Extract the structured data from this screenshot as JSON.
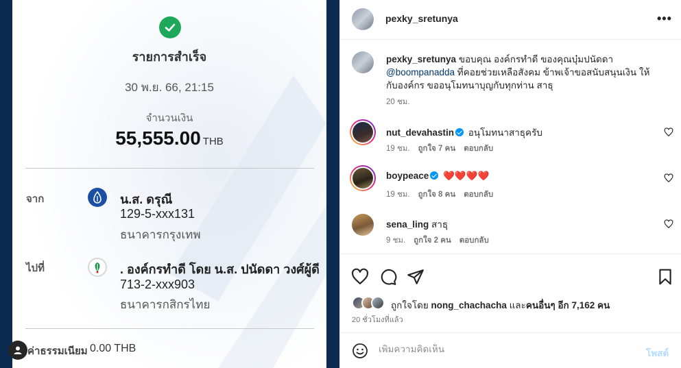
{
  "slip": {
    "title": "รายการสำเร็จ",
    "datetime": "30 พ.ย. 66, 21:15",
    "amount_label": "จำนวนเงิน",
    "amount": "55,555.00",
    "currency": "THB",
    "from_label": "จาก",
    "from_name": "น.ส. ดรุณี",
    "from_account": "129-5-xxx131",
    "from_bank": "ธนาคารกรุงเทพ",
    "to_label": "ไปที่",
    "to_name": ". องค์กรทำดี โดย น.ส. ปนัดดา  วงศ์ผู้ดี",
    "to_account": "713-2-xxx903",
    "to_bank": "ธนาคารกสิกรไทย",
    "fee_label": "ค่าธรรมเนียม",
    "fee_value": "0.00 THB"
  },
  "post": {
    "username": "pexky_sretunya",
    "more_icon": "more-horizontal-icon",
    "caption": {
      "username": "pexky_sretunya",
      "text1": "ขอบคุณ องค์กรทำดี ของคุณบุ๋มปนัดดา",
      "mention": "@boompanadda",
      "text2": "ที่คอยช่วยเหลือสังคม ข้าพเจ้าขอสนับสนุนเงิน ให้กับองค์กร ขออนุโมทนาบุญกับทุกท่าน สาธุ",
      "time": "20 ชม."
    },
    "comments": [
      {
        "username": "nut_devahastin",
        "verified": true,
        "text": "อนุโมทนาสาธุครับ",
        "time": "19 ชม.",
        "likes": "ถูกใจ 7 คน",
        "reply": "ตอบกลับ"
      },
      {
        "username": "boypeace",
        "verified": true,
        "text": "❤️❤️❤️❤️",
        "time": "19 ชม.",
        "likes": "ถูกใจ 8 คน",
        "reply": "ตอบกลับ"
      },
      {
        "username": "sena_ling",
        "verified": false,
        "text": "สาธุ",
        "time": "9 ชม.",
        "likes": "ถูกใจ 2 คน",
        "reply": "ตอบกลับ"
      }
    ],
    "likes_prefix": "ถูกใจโดย",
    "likes_user": "nong_chachacha",
    "likes_and": "และ",
    "likes_others": "คนอื่นๆ อีก 7,162 คน",
    "post_time": "20 ชั่วโมงที่แล้ว",
    "comment_placeholder": "เพิ่มความคิดเห็น",
    "post_button": "โพสต์"
  },
  "colors": {
    "accent": "#0095f6",
    "success": "#1ea85a",
    "navy": "#0c2b52"
  }
}
